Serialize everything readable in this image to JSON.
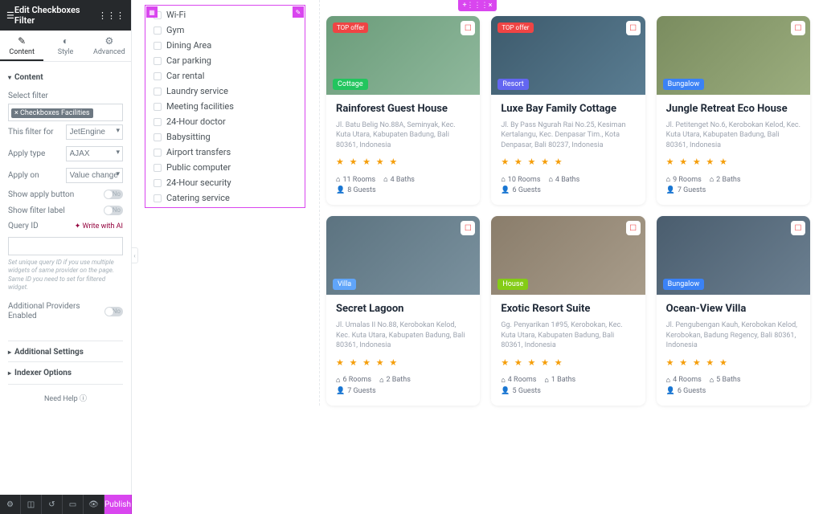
{
  "header": {
    "title": "Edit Checkboxes Filter"
  },
  "tabs": {
    "content": "Content",
    "style": "Style",
    "advanced": "Advanced"
  },
  "sections": {
    "content": "Content",
    "additional": "Additional Settings",
    "indexer": "Indexer Options"
  },
  "fields": {
    "select_filter_label": "Select filter",
    "select_filter_value": "× Checkboxes Facilities",
    "this_filter_for_label": "This filter for",
    "this_filter_for_value": "JetEngine",
    "apply_type_label": "Apply type",
    "apply_type_value": "AJAX",
    "apply_on_label": "Apply on",
    "apply_on_value": "Value change",
    "show_apply_button": "Show apply button",
    "show_filter_label": "Show filter label",
    "query_id_label": "Query ID",
    "ai_link": "✦ Write with AI",
    "query_help": "Set unique query ID if you use multiple widgets of same provider on the page. Same ID you need to set for filtered widget.",
    "additional_providers": "Additional Providers Enabled",
    "toggle_no": "No",
    "need_help": "Need Help"
  },
  "footer": {
    "publish": "Publish"
  },
  "filter_items": [
    "Wi-Fi",
    "Gym",
    "Dining Area",
    "Car parking",
    "Car rental",
    "Laundry service",
    "Meeting facilities",
    "24-Hour doctor",
    "Babysitting",
    "Airport transfers",
    "Public computer",
    "24-Hour security",
    "Catering service"
  ],
  "listings": [
    {
      "badge": "Cottage",
      "badge_class": "cottage",
      "top_offer": "TOP offer",
      "img": "c1",
      "title": "Rainforest Guest House",
      "addr": "Jl. Batu Belig No.88A, Seminyak, Kec. Kuta Utara, Kabupaten Badung, Bali 80361, Indonesia",
      "rooms": "11 Rooms",
      "baths": "4 Baths",
      "guests": "8 Guests"
    },
    {
      "badge": "Resort",
      "badge_class": "resort",
      "top_offer": "TOP offer",
      "img": "c2",
      "title": "Luxe Bay Family Cottage",
      "addr": "Jl. By Pass Ngurah Rai No.25, Kesiman Kertalangu, Kec. Denpasar Tim., Kota Denpasar, Bali 80237, Indonesia",
      "rooms": "10 Rooms",
      "baths": "4 Baths",
      "guests": "6 Guests"
    },
    {
      "badge": "Bungalow",
      "badge_class": "bungalow",
      "top_offer": "",
      "img": "c3",
      "title": "Jungle Retreat Eco House",
      "addr": "Jl. Petitenget No.6, Kerobokan Kelod, Kec. Kuta Utara, Kabupaten Badung, Bali 80361, Indonesia",
      "rooms": "9 Rooms",
      "baths": "2 Baths",
      "guests": "7 Guests"
    },
    {
      "badge": "Villa",
      "badge_class": "villa",
      "top_offer": "",
      "img": "c4",
      "title": "Secret Lagoon",
      "addr": "Jl. Umalas II No.88, Kerobokan Kelod, Kec. Kuta Utara, Kabupaten Badung, Bali 80361, Indonesia",
      "rooms": "6 Rooms",
      "baths": "2 Baths",
      "guests": "7 Guests"
    },
    {
      "badge": "House",
      "badge_class": "house",
      "top_offer": "",
      "img": "c5",
      "title": "Exotic Resort Suite",
      "addr": "Gg. Penyarikan 1#95, Kerobokan, Kec. Kuta Utara, Kabupaten Badung, Bali 80361, Indonesia",
      "rooms": "4 Rooms",
      "baths": "1 Baths",
      "guests": "5 Guests"
    },
    {
      "badge": "Bungalow",
      "badge_class": "bungalow",
      "top_offer": "",
      "img": "c6",
      "title": "Ocean-View Villa",
      "addr": "Jl. Pengubengan Kauh, Kerobokan Kelod, Kerobokan, Badung Regency, Bali 80361, Indonesia",
      "rooms": "4 Rooms",
      "baths": "5 Baths",
      "guests": "6 Guests"
    }
  ]
}
